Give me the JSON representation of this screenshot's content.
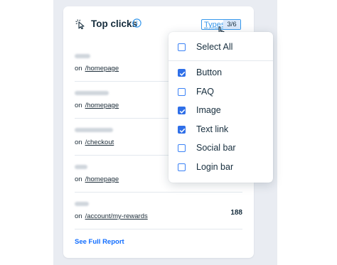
{
  "widget": {
    "title": "Top clicks",
    "types_button": {
      "label": "Types",
      "count": "3/6"
    },
    "see_full_report": "See Full Report"
  },
  "rows": [
    {
      "prefix": "on",
      "path": "/homepage",
      "value": ""
    },
    {
      "prefix": "on",
      "path": "/homepage",
      "value": ""
    },
    {
      "prefix": "on",
      "path": "/checkout",
      "value": ""
    },
    {
      "prefix": "on",
      "path": "/homepage",
      "value": ""
    },
    {
      "prefix": "on",
      "path": "/account/my-rewards",
      "value": "188"
    }
  ],
  "dropdown": {
    "select_all": {
      "label": "Select All",
      "checked": false
    },
    "options": [
      {
        "label": "Button",
        "checked": true
      },
      {
        "label": "FAQ",
        "checked": false
      },
      {
        "label": "Image",
        "checked": true
      },
      {
        "label": "Text link",
        "checked": true
      },
      {
        "label": "Social bar",
        "checked": false
      },
      {
        "label": "Login bar",
        "checked": false
      }
    ]
  },
  "colors": {
    "accent": "#3899ec",
    "checkbox_checked": "#2f6fe8",
    "link_blue": "#116dff",
    "backdrop": "#e9ecf2"
  },
  "icons": {
    "header": "cursor-click-icon",
    "info": "info-icon",
    "pointer": "hand-pointer-icon"
  }
}
